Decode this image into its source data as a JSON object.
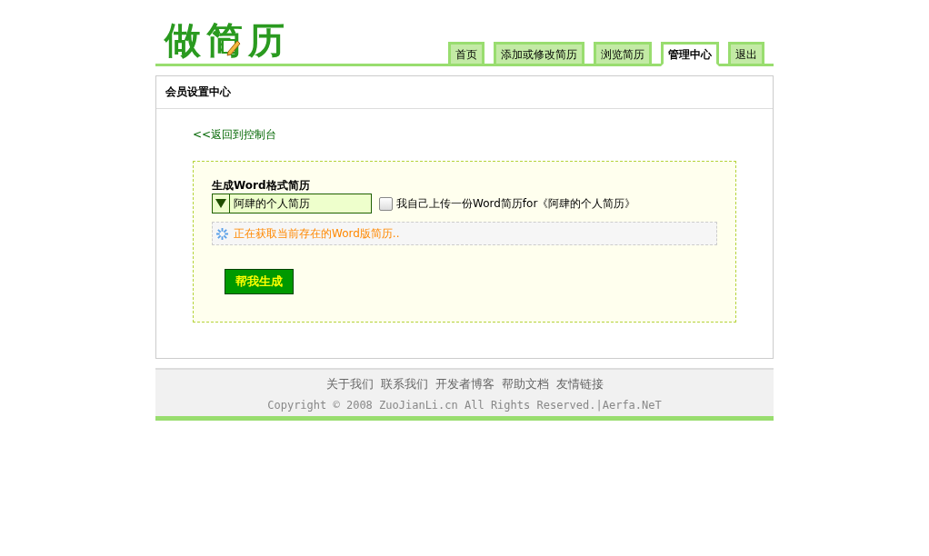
{
  "logo": {
    "text": "做简历"
  },
  "tabs": [
    {
      "label": "首页",
      "selected": false
    },
    {
      "label": "添加或修改简历",
      "selected": false
    },
    {
      "label": "浏览简历",
      "selected": false
    },
    {
      "label": "管理中心",
      "selected": true
    },
    {
      "label": "退出",
      "selected": false
    }
  ],
  "panel": {
    "title": "会员设置中心",
    "back_link": "<<返回到控制台",
    "section_title": "生成Word格式简历",
    "select": {
      "value": "阿肆的个人简历"
    },
    "upload_checkbox": {
      "label": "我自己上传一份Word简历for《阿肆的个人简历》",
      "checked": false
    },
    "status": "正在获取当前存在的Word版简历..",
    "button": "帮我生成"
  },
  "footer": {
    "links": [
      "关于我们",
      "联系我们",
      "开发者博客",
      "帮助文档",
      "友情链接"
    ],
    "copyright": "Copyright © 2008 ZuoJianLi.cn All Rights Reserved.|Aerfa.NeT"
  }
}
